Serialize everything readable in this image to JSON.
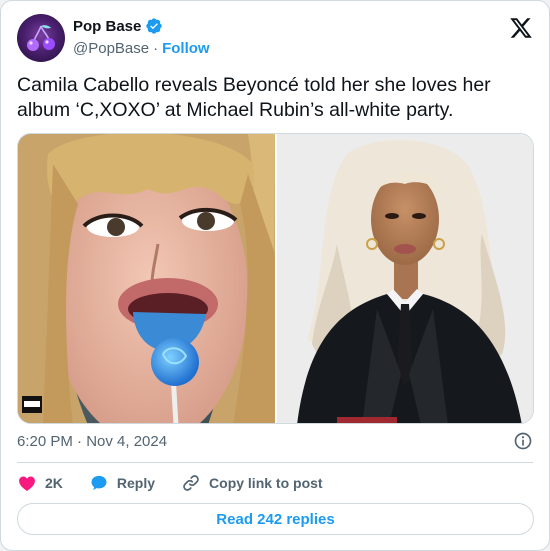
{
  "account": {
    "name": "Pop Base",
    "handle": "@PopBase",
    "separator": "·",
    "follow_label": "Follow",
    "avatar_icon": "cherry-logo"
  },
  "tweet": {
    "text": "Camila Cabello reveals Beyoncé told her she loves her album ‘C,XOXO’ at Michael Rubin’s all-white party.",
    "timestamp": "6:20 PM · Nov 4, 2024"
  },
  "media": {
    "photos": [
      {
        "subject": "woman with blonde bangs holding a blue lollipop on her tongue",
        "badge_text": "PARENTAL ADVISORY EXPLICIT CONTENT"
      },
      {
        "subject": "woman with platinum blonde waves in a black suit with white collar and black tie"
      }
    ]
  },
  "actions": {
    "like_count": "2K",
    "reply_label": "Reply",
    "copy_label": "Copy link to post",
    "read_replies_label": "Read 242 replies"
  },
  "colors": {
    "accent": "#1d9bf0",
    "like": "#f91880",
    "text": "#0f1419",
    "secondary": "#536471",
    "border": "#cfd9de"
  }
}
